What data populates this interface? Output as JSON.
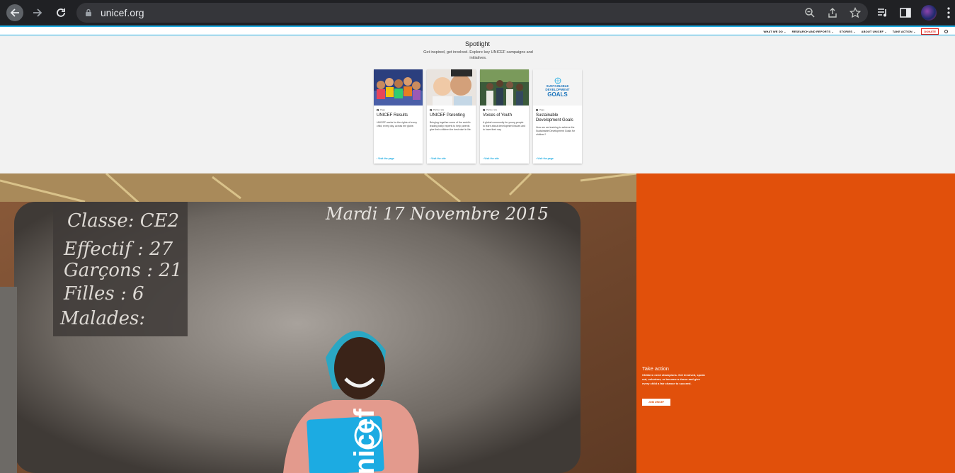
{
  "browser": {
    "url": "unicef.org",
    "icons": [
      "back-icon",
      "forward-icon",
      "reload-icon",
      "lock-icon",
      "zoom-icon",
      "share-icon",
      "bookmark-star-icon",
      "media-queue-icon",
      "side-panel-icon",
      "profile-avatar",
      "more-menu-icon"
    ]
  },
  "nav": {
    "items": [
      "WHAT WE DO",
      "RESEARCH AND REPORTS",
      "STORIES",
      "ABOUT UNICEF",
      "TAKE ACTION"
    ],
    "donate": "DONATE"
  },
  "spotlight": {
    "title": "Spotlight",
    "subtitle": "Get inspired, get involved. Explore key UNICEF campaigns and initiatives.",
    "cards": [
      {
        "tag": "Page",
        "title": "UNICEF Results",
        "description": "UNICEF works for the rights of every child, every day, across the globe.",
        "link": "Visit the page"
      },
      {
        "tag": "Partner site",
        "title": "UNICEF Parenting",
        "description": "Bringing together some of the world's leading baby experts to help parents give their children the best start in life.",
        "link": "Visit the site"
      },
      {
        "tag": "Partner site",
        "title": "Voices of Youth",
        "description": "A global community for young people to learn about development issues and to have their say.",
        "link": "Visit the site"
      },
      {
        "tag": "Page",
        "title": "Sustainable Development Goals",
        "description": "How are we tracking to achieve the Sustainable Development Goals for children?",
        "link": "Visit the page",
        "logo_text": [
          "SUSTAINABLE",
          "DEVELOPMENT",
          "GOALS"
        ]
      }
    ]
  },
  "hero": {
    "chalkboard": [
      "Classe: CE2",
      "Effectif : 27",
      "Garçons : 21",
      "Filles : 6",
      "Malades:",
      "Mardi 17 Novembre 2015"
    ],
    "bag_text": "unicef",
    "take_action": {
      "title": "Take action",
      "text": "Children need champions. Get involved, speak out, volunteer, or become a donor and give every child a fair chance to succeed.",
      "button": "JOIN UNICEF"
    }
  },
  "colors": {
    "chrome_bg": "#202124",
    "unicef_blue": "#1cabe2",
    "panel_orange": "#e1500b",
    "donate_red": "#e2231a"
  }
}
